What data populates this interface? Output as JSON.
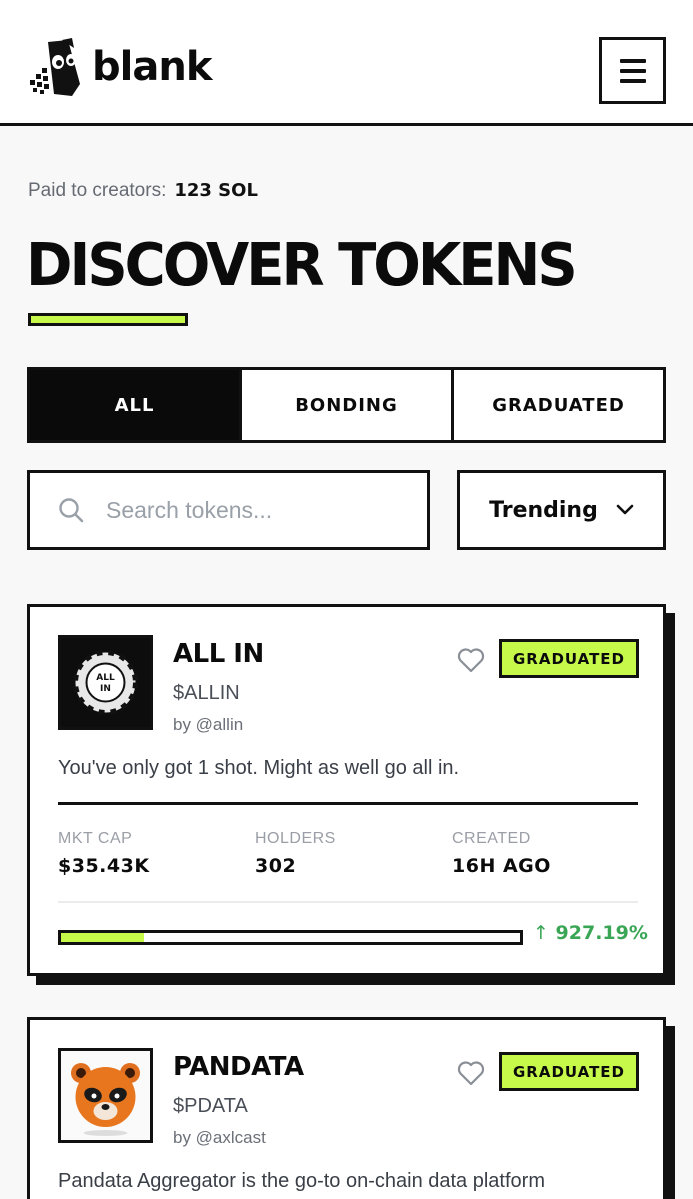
{
  "brand": {
    "name": "blank"
  },
  "stats": {
    "paid_label": "Paid to creators:",
    "paid_value": "123 SOL"
  },
  "page": {
    "title": "DISCOVER TOKENS"
  },
  "tabs": [
    {
      "label": "ALL",
      "active": true
    },
    {
      "label": "BONDING",
      "active": false
    },
    {
      "label": "GRADUATED",
      "active": false
    }
  ],
  "search": {
    "placeholder": "Search tokens..."
  },
  "sort": {
    "selected": "Trending"
  },
  "colors": {
    "accent": "#c7f94a",
    "ink": "#111111",
    "positive": "#3aa655"
  },
  "tokens": [
    {
      "name": "ALL IN",
      "symbol": "$ALLIN",
      "creator": "by @allin",
      "badge": "GRADUATED",
      "description": "You've only got 1 shot. Might as well go all in.",
      "mkt_cap_label": "MKT CAP",
      "mkt_cap": "$35.43K",
      "holders_label": "HOLDERS",
      "holders": "302",
      "created_label": "CREATED",
      "created": "16H AGO",
      "progress": 0.18,
      "change": "927.19%"
    },
    {
      "name": "PANDATA",
      "symbol": "$PDATA",
      "creator": "by @axlcast",
      "badge": "GRADUATED",
      "description": "Pandata Aggregator is the go-to on-chain data platform"
    }
  ]
}
